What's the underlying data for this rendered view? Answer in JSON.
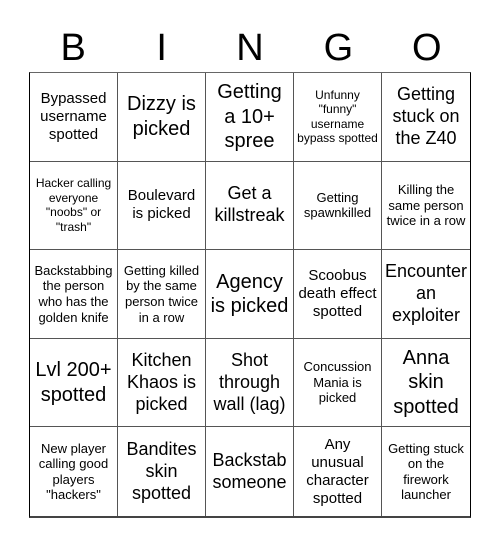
{
  "header": {
    "letters": [
      "B",
      "I",
      "N",
      "G",
      "O"
    ]
  },
  "board": {
    "cells": [
      "Bypassed username spotted",
      "Dizzy is picked",
      "Getting a 10+ spree",
      "Unfunny \"funny\" username bypass spotted",
      "Getting stuck on the Z40",
      "Hacker calling everyone \"noobs\" or \"trash\"",
      "Boulevard is picked",
      "Get a killstreak",
      "Getting spawnkilled",
      "Killing the same person twice in a row",
      "Backstabbing the person who has the golden knife",
      "Getting killed by the same person twice in a row",
      "Agency is picked",
      "Scoobus death effect spotted",
      "Encounter an exploiter",
      "Lvl 200+ spotted",
      "Kitchen Khaos is picked",
      "Shot through wall (lag)",
      "Concussion Mania is picked",
      "Anna skin spotted",
      "New player calling good players \"hackers\"",
      "Bandites skin spotted",
      "Backstab someone",
      "Any unusual character spotted",
      "Getting stuck on the firework launcher"
    ]
  }
}
